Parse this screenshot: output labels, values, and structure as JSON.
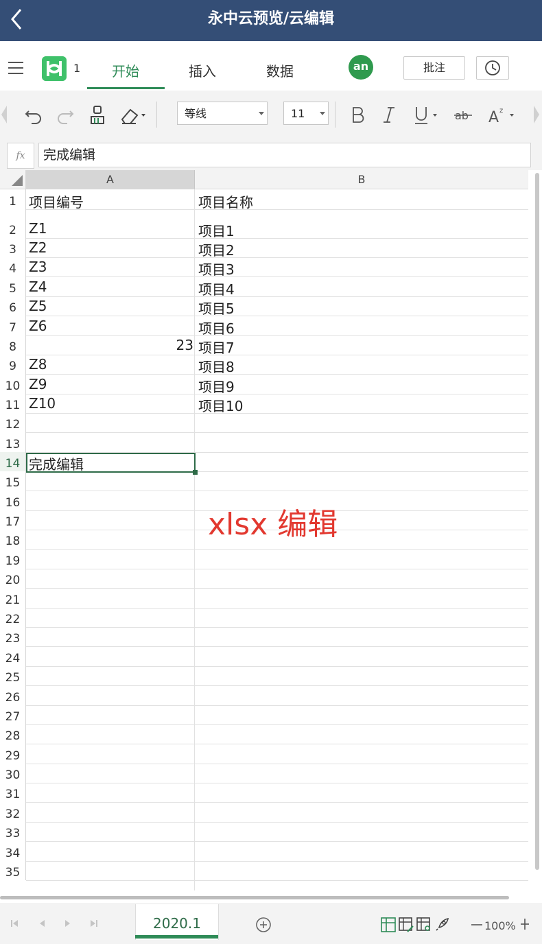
{
  "header": {
    "title": "永中云预览/云编辑"
  },
  "menu": {
    "doc_count": "1",
    "tabs": [
      {
        "label": "开始"
      },
      {
        "label": "插入"
      },
      {
        "label": "数据"
      }
    ],
    "avatar_text": "an",
    "comment_label": "批注"
  },
  "toolbar": {
    "font_name": "等线",
    "font_size": "11"
  },
  "formula": {
    "fx_label": "fx",
    "value": "完成编辑"
  },
  "grid": {
    "columns": [
      "A",
      "B"
    ],
    "rows": [
      {
        "n": "1",
        "a": "项目编号",
        "b": "项目名称"
      },
      {
        "n": "2",
        "a": "Z1",
        "b": "项目1"
      },
      {
        "n": "3",
        "a": "Z2",
        "b": "项目2"
      },
      {
        "n": "4",
        "a": "Z3",
        "b": "项目3"
      },
      {
        "n": "5",
        "a": "Z4",
        "b": "项目4"
      },
      {
        "n": "6",
        "a": "Z5",
        "b": "项目5"
      },
      {
        "n": "7",
        "a": "Z6",
        "b": "项目6"
      },
      {
        "n": "8",
        "a": "23",
        "b": "项目7",
        "a_numeric": true
      },
      {
        "n": "9",
        "a": "Z8",
        "b": "项目8"
      },
      {
        "n": "10",
        "a": "Z9",
        "b": "项目9"
      },
      {
        "n": "11",
        "a": "Z10",
        "b": "项目10"
      },
      {
        "n": "12",
        "a": "",
        "b": ""
      },
      {
        "n": "13",
        "a": "",
        "b": ""
      },
      {
        "n": "14",
        "a": "完成编辑",
        "b": "",
        "selected": true
      },
      {
        "n": "15",
        "a": "",
        "b": ""
      },
      {
        "n": "16",
        "a": "",
        "b": ""
      },
      {
        "n": "17",
        "a": "",
        "b": ""
      },
      {
        "n": "18",
        "a": "",
        "b": ""
      },
      {
        "n": "19",
        "a": "",
        "b": ""
      },
      {
        "n": "20",
        "a": "",
        "b": ""
      },
      {
        "n": "21",
        "a": "",
        "b": ""
      },
      {
        "n": "22",
        "a": "",
        "b": ""
      },
      {
        "n": "23",
        "a": "",
        "b": ""
      },
      {
        "n": "24",
        "a": "",
        "b": ""
      },
      {
        "n": "25",
        "a": "",
        "b": ""
      },
      {
        "n": "26",
        "a": "",
        "b": ""
      },
      {
        "n": "27",
        "a": "",
        "b": ""
      },
      {
        "n": "28",
        "a": "",
        "b": ""
      },
      {
        "n": "29",
        "a": "",
        "b": ""
      },
      {
        "n": "30",
        "a": "",
        "b": ""
      },
      {
        "n": "31",
        "a": "",
        "b": ""
      },
      {
        "n": "32",
        "a": "",
        "b": ""
      },
      {
        "n": "33",
        "a": "",
        "b": ""
      },
      {
        "n": "34",
        "a": "",
        "b": ""
      },
      {
        "n": "35",
        "a": "",
        "b": ""
      }
    ]
  },
  "overlay_text": "xlsx 编辑",
  "footer": {
    "sheet_name": "2020.1",
    "zoom": "100%"
  },
  "colors": {
    "header_bg": "#344e76",
    "accent": "#2e8b57",
    "overlay": "#e2382f"
  }
}
